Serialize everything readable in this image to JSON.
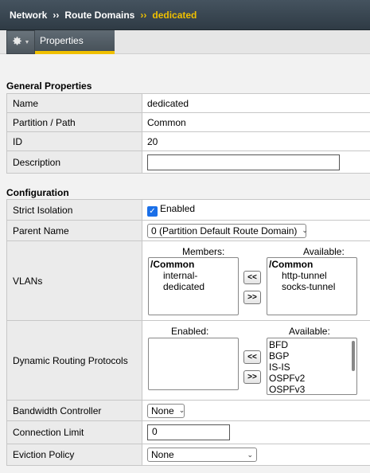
{
  "breadcrumb": {
    "items": [
      "Network",
      "Route Domains"
    ],
    "separator": "››",
    "current": "dedicated"
  },
  "tabs": {
    "gear_icon": "gear-icon",
    "properties": "Properties"
  },
  "general": {
    "title": "General Properties",
    "name_label": "Name",
    "name_value": "dedicated",
    "partition_label": "Partition / Path",
    "partition_value": "Common",
    "id_label": "ID",
    "id_value": "20",
    "description_label": "Description",
    "description_value": ""
  },
  "config": {
    "title": "Configuration",
    "strict_label": "Strict Isolation",
    "strict_value": "Enabled",
    "strict_checked": true,
    "parent_label": "Parent Name",
    "parent_value": "0 (Partition Default Route Domain)",
    "vlans_label": "VLANs",
    "vlans_members_head": "Members:",
    "vlans_available_head": "Available:",
    "vlans_members": {
      "group": "/Common",
      "items": [
        "internal-dedicated"
      ]
    },
    "vlans_available": {
      "group": "/Common",
      "items": [
        "http-tunnel",
        "socks-tunnel"
      ]
    },
    "move_left": "<<",
    "move_right": ">>",
    "drp_label": "Dynamic Routing Protocols",
    "drp_enabled_head": "Enabled:",
    "drp_available_head": "Available:",
    "drp_available": [
      "BFD",
      "BGP",
      "IS-IS",
      "OSPFv2",
      "OSPFv3"
    ],
    "bw_label": "Bandwidth Controller",
    "bw_value": "None",
    "conn_label": "Connection Limit",
    "conn_value": "0",
    "evict_label": "Eviction Policy",
    "evict_value": "None"
  }
}
